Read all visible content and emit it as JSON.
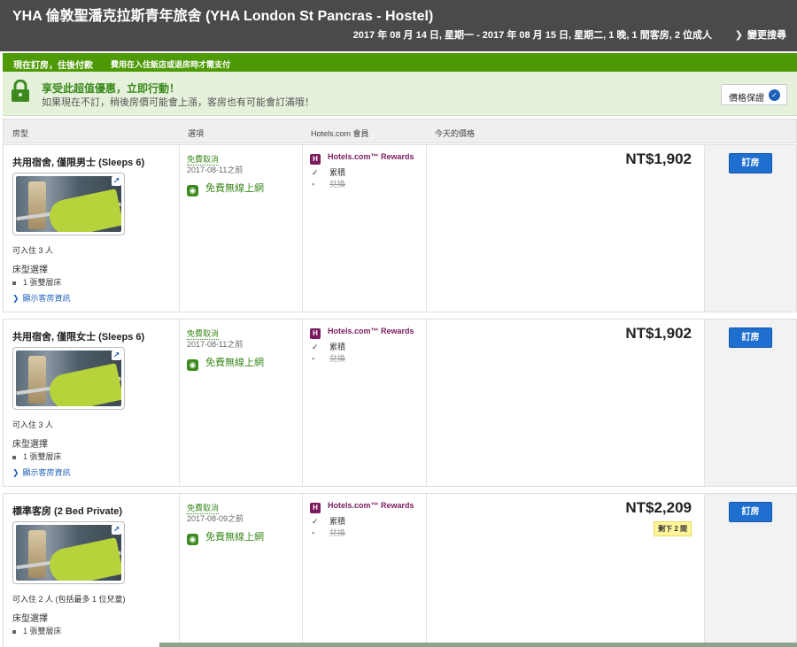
{
  "header": {
    "title": "YHA 倫敦聖潘克拉斯青年旅舍 (YHA London St Pancras - Hostel)",
    "dates": "2017 年 08 月 14 日, 星期一 - 2017 年 08 月 15 日, 星期二, 1 晚, 1 間客房, 2 位成人",
    "change_search": "變更搜尋"
  },
  "paybar": {
    "main": "現在訂房，住後付款",
    "sub": "費用在入住飯店或退房時才需支付"
  },
  "promo": {
    "headline": "享受此超值優惠，立即行動！",
    "body": "如果現在不訂，稍後房價可能會上漲，客房也有可能會訂滿哦！",
    "guarantee_button": "價格保證"
  },
  "table_headers": [
    "房型",
    "選項",
    "Hotels.com 會員",
    "今天的價格"
  ],
  "rooms": [
    {
      "name": "共用宿舍, 僅限男士 (Sleeps 6)",
      "occupancy": "可入住 3 人",
      "bed_label": "床型選擇",
      "bed_type": "1 張雙層床",
      "info_link": "顯示客房資訊",
      "cancel": "免費取消",
      "cancel_before": "2017-08-11之前",
      "wifi": "免費無線上網",
      "rewards": "Hotels.com™ Rewards",
      "earn": "累積",
      "redeem": "兌換",
      "price": "NT$1,902",
      "rooms_left": "",
      "book": "訂房"
    },
    {
      "name": "共用宿舍, 僅限女士 (Sleeps 6)",
      "occupancy": "可入住 3 人",
      "bed_label": "床型選擇",
      "bed_type": "1 張雙層床",
      "info_link": "顯示客房資訊",
      "cancel": "免費取消",
      "cancel_before": "2017-08-11之前",
      "wifi": "免費無線上網",
      "rewards": "Hotels.com™ Rewards",
      "earn": "累積",
      "redeem": "兌換",
      "price": "NT$1,902",
      "rooms_left": "",
      "book": "訂房"
    },
    {
      "name": "標準客房 (2 Bed Private)",
      "occupancy": "可入住 2 人 (包括最多 1 位兒童)",
      "bed_label": "床型選擇",
      "bed_type": "1 張雙層床",
      "info_link": "",
      "cancel": "免費取消",
      "cancel_before": "2017-08-09之前",
      "wifi": "免費無線上網",
      "rewards": "Hotels.com™ Rewards",
      "earn": "累積",
      "redeem": "兌換",
      "price": "NT$2,209",
      "rooms_left": "剩下 2 間",
      "book": "訂房"
    }
  ],
  "colors": {
    "header_bg": "#4a4a4a",
    "green": "#4e9a06",
    "rewards_purple": "#7b1b5e",
    "book_blue": "#1e6fd0"
  }
}
